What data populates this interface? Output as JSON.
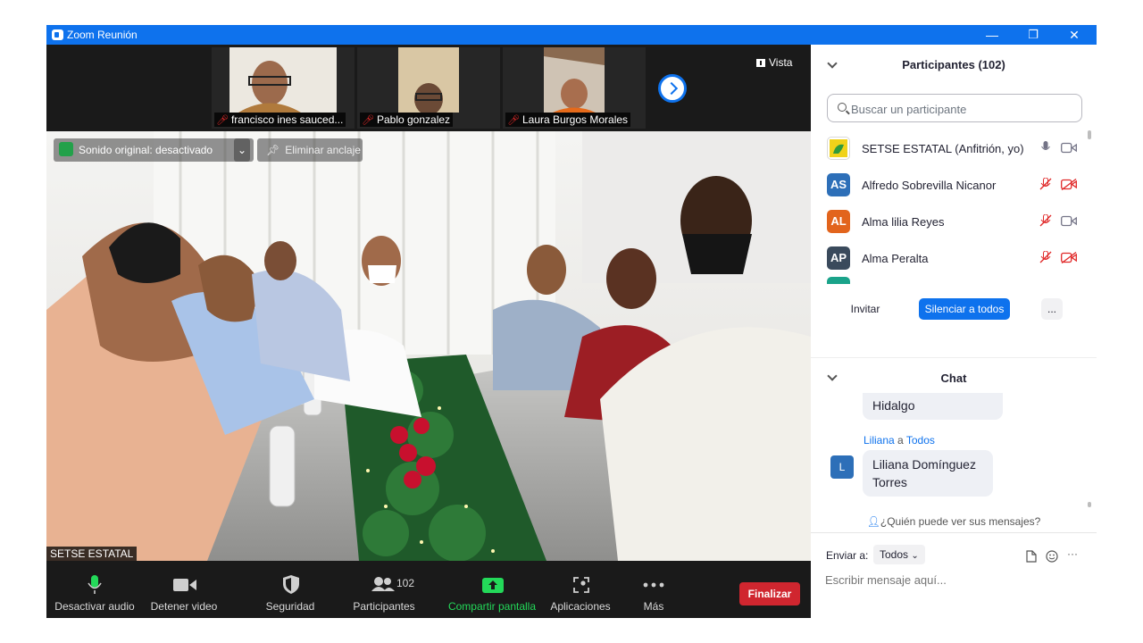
{
  "window": {
    "title": "Zoom Reunión",
    "minimize_glyph": "—",
    "restore_glyph": "❐",
    "close_glyph": "✕"
  },
  "strip": {
    "tiles": [
      {
        "name": "francisco ines sauced..."
      },
      {
        "name": "Pablo gonzalez"
      },
      {
        "name": "Laura Burgos Morales"
      }
    ],
    "view_label": "Vista"
  },
  "main_video": {
    "speaker_name": "SETSE ESTATAL",
    "original_sound_label": "Sonido original: desactivado",
    "unpin_label": "Eliminar anclaje"
  },
  "toolbar": {
    "mute": "Desactivar audio",
    "video": "Detener video",
    "security": "Seguridad",
    "participants": "Participantes",
    "participants_count": "102",
    "share": "Compartir pantalla",
    "apps": "Aplicaciones",
    "more": "Más",
    "end": "Finalizar"
  },
  "participants_panel": {
    "title": "Participantes (102)",
    "search_placeholder": "Buscar un participante",
    "people": [
      {
        "initials": "",
        "name": "SETSE ESTATAL (Anfitrión, yo)",
        "color": "#ffffff"
      },
      {
        "initials": "AS",
        "name": "Alfredo Sobrevilla Nicanor",
        "color": "#2d6fb8"
      },
      {
        "initials": "AL",
        "name": "Alma lilia Reyes",
        "color": "#e2641c"
      },
      {
        "initials": "AP",
        "name": "Alma Peralta",
        "color": "#3a4a5c"
      }
    ],
    "invite": "Invitar",
    "mute_all": "Silenciar a todos",
    "more": "..."
  },
  "chat": {
    "title": "Chat",
    "prev_message_tail": "Hidalgo",
    "sender": "Liliana",
    "to_word": "a",
    "recipient": "Todos",
    "sender_initial": "L",
    "message": "Liliana Domínguez Torres",
    "who_can_see": "¿Quién puede ver sus mensajes?",
    "send_to_label": "Enviar a:",
    "send_to_value": "Todos",
    "input_placeholder": "Escribir mensaje aquí...",
    "more_glyph": "···"
  },
  "colors": {
    "zoom_blue": "#0e72ed",
    "end_red": "#d0262f",
    "share_green": "#23d959",
    "muted_red": "#e02828"
  }
}
